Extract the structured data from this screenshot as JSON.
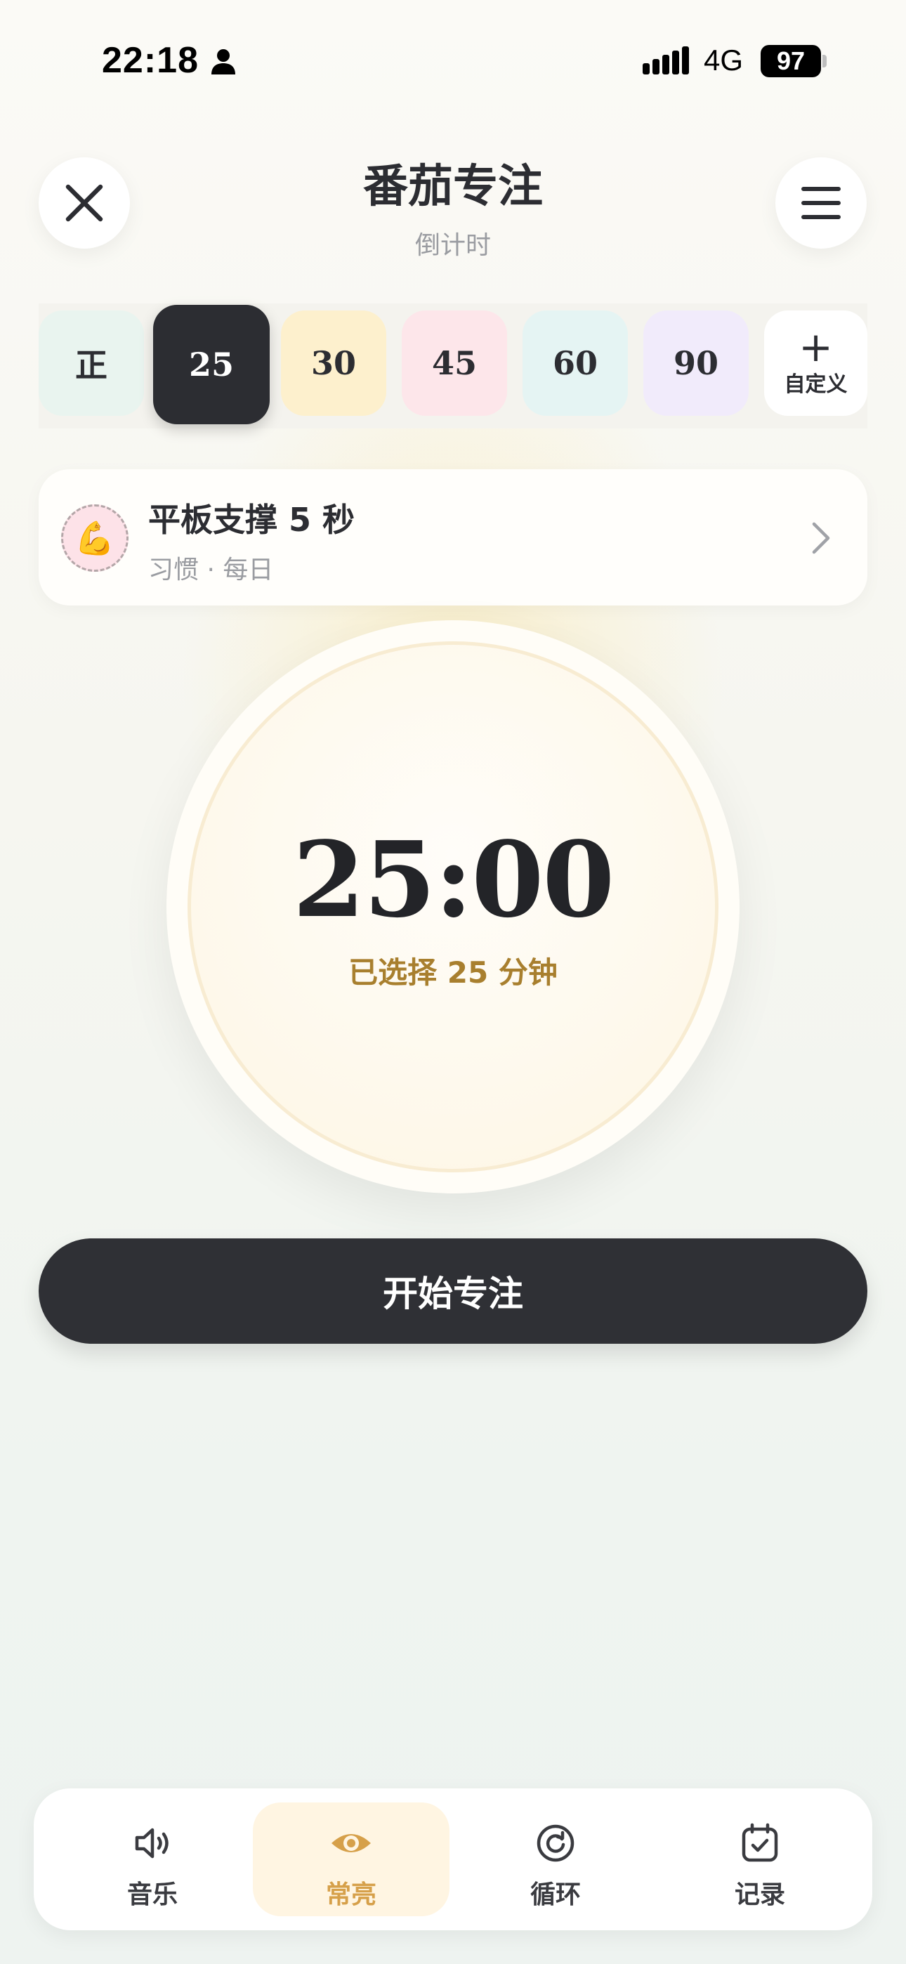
{
  "status_bar": {
    "time": "22:18",
    "network": "4G",
    "battery": "97"
  },
  "header": {
    "title": "番茄专注",
    "subtitle": "倒计时"
  },
  "chips": [
    {
      "label": "正",
      "color": "#e9f4ef"
    },
    {
      "label": "25",
      "color": "#2c2d32",
      "selected": true
    },
    {
      "label": "30",
      "color": "#fdf0cd"
    },
    {
      "label": "45",
      "color": "#fde6ea"
    },
    {
      "label": "60",
      "color": "#e5f4f3"
    },
    {
      "label": "90",
      "color": "#f1ebfb"
    }
  ],
  "custom_chip": {
    "plus": "+",
    "label": "自定义"
  },
  "habit": {
    "title": "平板支撑 5 秒",
    "subtitle": "习惯 · 每日",
    "icon": "flexed-biceps-emoji",
    "emoji": "💪"
  },
  "timer": {
    "value": "25:00",
    "caption": "已选择 25 分钟"
  },
  "start_button": {
    "label": "开始专注"
  },
  "bottom_nav": [
    {
      "label": "音乐",
      "icon": "speaker-icon"
    },
    {
      "label": "常亮",
      "icon": "eye-icon",
      "active": true
    },
    {
      "label": "循环",
      "icon": "refresh-icon"
    },
    {
      "label": "记录",
      "icon": "calendar-check-icon"
    }
  ],
  "colors": {
    "accent": "#d6a04a",
    "dark": "#2c2d32",
    "caption": "#a87f2e"
  }
}
